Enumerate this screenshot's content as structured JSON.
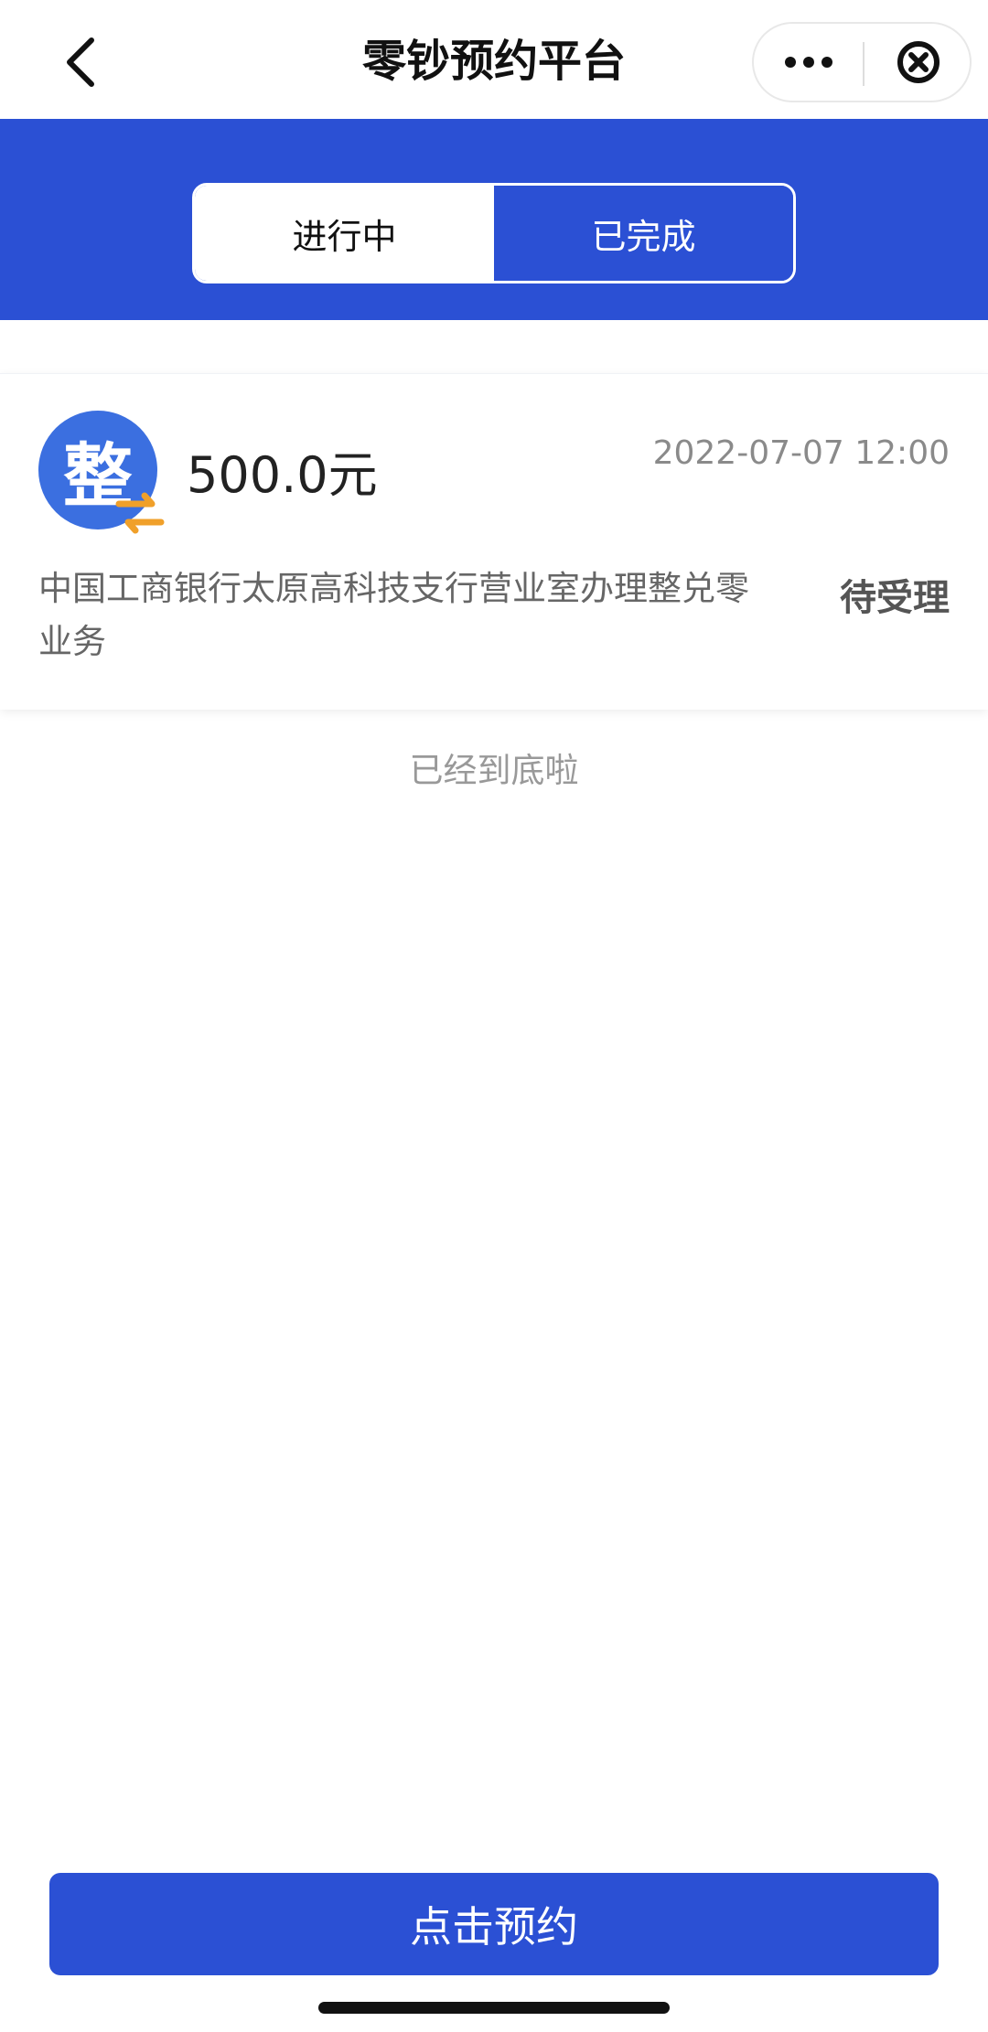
{
  "header": {
    "title": "零钞预约平台",
    "back_icon": "chevron-left-icon",
    "more_icon": "more-dots-icon",
    "close_icon": "close-circle-icon"
  },
  "tabs": [
    {
      "label": "进行中",
      "active": true
    },
    {
      "label": "已完成",
      "active": false
    }
  ],
  "records": [
    {
      "logo_char": "整",
      "amount": "500.0元",
      "datetime": "2022-07-07 12:00",
      "description": "中国工商银行太原高科技支行营业室办理整兑零业务",
      "status": "待受理"
    }
  ],
  "list_end_text": "已经到底啦",
  "book_button_label": "点击预约",
  "colors": {
    "primary": "#2b50d4",
    "logo_blue": "#3b6fe0",
    "swap_orange": "#f0a02a"
  }
}
